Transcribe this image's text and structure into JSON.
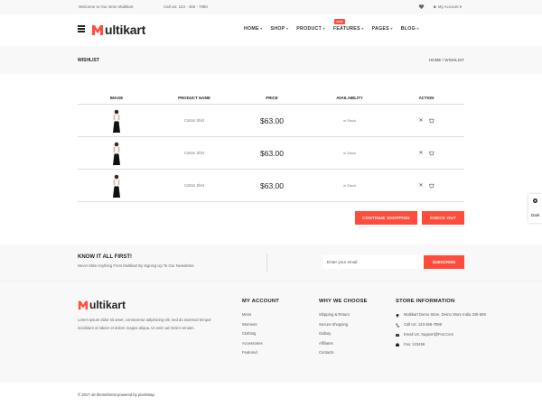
{
  "topbar": {
    "welcome": "Welcome to Our store Multikart",
    "phone": "Call Us: 123 - 456 - 7890",
    "account": "My Account"
  },
  "header": {
    "logo_letter": "M",
    "logo_text": "ultikart",
    "nav": [
      {
        "label": "HOME"
      },
      {
        "label": "SHOP"
      },
      {
        "label": "PRODUCT"
      },
      {
        "label": "FEATURES"
      },
      {
        "label": "PAGES"
      },
      {
        "label": "BLOG"
      }
    ],
    "new_badge": "new"
  },
  "breadcrumb": {
    "title": "WISHLIST",
    "trail": "HOME  /  WISHLIST"
  },
  "table": {
    "headers": [
      "IMAGE",
      "PRODUCT NAME",
      "PRICE",
      "AVAILABILITY",
      "ACTION"
    ],
    "rows": [
      {
        "name": "Cotton Shirt",
        "price": "$63.00",
        "availability": "in Stock"
      },
      {
        "name": "Cotton Shirt",
        "price": "$63.00",
        "availability": "in Stock"
      },
      {
        "name": "Cotton Shirt",
        "price": "$63.00",
        "availability": "in Stock"
      }
    ]
  },
  "buttons": {
    "continue": "CONTINUE SHOPPING",
    "checkout": "CHECK OUT"
  },
  "side_toggle": {
    "label": "Dark"
  },
  "newsletter": {
    "heading": "KNOW IT ALL FIRST!",
    "subtext": "Never Miss Anything From Multikart By Signing Up To Our Newsletter.",
    "placeholder": "Enter your email",
    "subscribe": "SUBSCRIBE"
  },
  "footer": {
    "logo_letter": "M",
    "logo_text": "ultikart",
    "description": "Lorem ipsum dolor sit amet, consectetur adipisicing elit, sed do eiusmod tempor incididunt ut labore et dolore magna aliqua. Ut enim ad minim veniam.",
    "social_icons": [
      "facebook-icon",
      "google-plus-icon",
      "twitter-icon",
      "instagram-icon",
      "rss-icon"
    ],
    "my_account": {
      "title": "MY ACCOUNT",
      "links": [
        "Mens",
        "Womens",
        "Clothing",
        "Accessories",
        "Featured"
      ]
    },
    "why_we_choose": {
      "title": "WHY WE CHOOSE",
      "links": [
        "Shipping & Return",
        "Secure Shopping",
        "Gallary",
        "Affiliates",
        "Contacts"
      ]
    },
    "store_info": {
      "title": "STORE INFORMATION",
      "address": "Multikart Demo Store, Demo Store India 345-659",
      "phone": "Call Us: 123-456-7898",
      "email": "Email Us: Support@Fiot.Com",
      "fax": "Fax: 123456"
    }
  },
  "bottom": {
    "copyright": "© 2017-18 themeforest powered by pixelstrap"
  },
  "colors": {
    "accent": "#ff4c3b",
    "light_bg": "#f8f8f8"
  }
}
